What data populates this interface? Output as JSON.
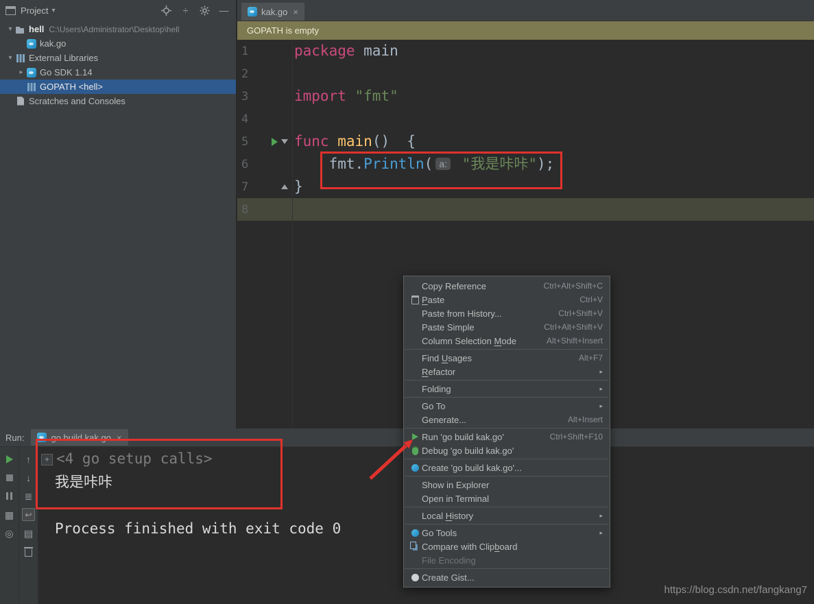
{
  "window": {
    "watermark": "https://blog.csdn.net/fangkang7"
  },
  "colors": {
    "annotation-red": "#e0322c",
    "selection-blue": "#2e5a8f",
    "banner-olive": "#7d7950",
    "keyword": "#cc4a7d",
    "string-green": "#6a8759",
    "function-yellow": "#ffc66d",
    "call-blue": "#4a9fd8",
    "plain-text": "#a9b7c6",
    "current-line": "#45483a",
    "run-green": "#4fa553"
  },
  "project_panel": {
    "title": "Project",
    "toolbar_icons": [
      "locate",
      "collapse-all",
      "settings",
      "hide"
    ],
    "tree": [
      {
        "label": "hell",
        "path": "C:\\Users\\Administrator\\Desktop\\hell",
        "icon": "folder",
        "chevron": "down",
        "depth": 0,
        "bold": true
      },
      {
        "label": "kak.go",
        "icon": "go-file",
        "chevron": "none",
        "depth": 1
      },
      {
        "label": "External Libraries",
        "icon": "library",
        "chevron": "down",
        "depth": 0
      },
      {
        "label": "Go SDK 1.14",
        "icon": "go-sdk",
        "chevron": "right",
        "depth": 1
      },
      {
        "label": "GOPATH <hell>",
        "icon": "library",
        "chevron": "none",
        "depth": 1,
        "selected": true
      },
      {
        "label": "Scratches and Consoles",
        "icon": "scratches",
        "chevron": "none",
        "depth": 0
      }
    ]
  },
  "editor": {
    "tab": {
      "label": "kak.go",
      "close": "×"
    },
    "banner": {
      "text": "GOPATH is empty"
    },
    "code": {
      "lines": [
        {
          "n": 1,
          "tokens": [
            {
              "t": "package",
              "c": "kw"
            },
            {
              "t": " main",
              "c": "pl"
            }
          ]
        },
        {
          "n": 2,
          "tokens": []
        },
        {
          "n": 3,
          "tokens": [
            {
              "t": "import",
              "c": "kw"
            },
            {
              "t": " ",
              "c": "pl"
            },
            {
              "t": "\"fmt\"",
              "c": "str"
            }
          ]
        },
        {
          "n": 4,
          "tokens": []
        },
        {
          "n": 5,
          "gutter": [
            "run",
            "fold-down"
          ],
          "tokens": [
            {
              "t": "func",
              "c": "kw"
            },
            {
              "t": " ",
              "c": "pl"
            },
            {
              "t": "main",
              "c": "fn"
            },
            {
              "t": "()  {",
              "c": "pl"
            }
          ]
        },
        {
          "n": 6,
          "tokens": [
            {
              "t": "    fmt.",
              "c": "pl"
            },
            {
              "t": "Println",
              "c": "call"
            },
            {
              "t": "(",
              "c": "pl"
            },
            {
              "hint": "a:"
            },
            {
              "t": " ",
              "c": "pl"
            },
            {
              "t": "\"我是咔咔\"",
              "c": "str"
            },
            {
              "t": ");",
              "c": "pl"
            }
          ]
        },
        {
          "n": 7,
          "gutter": [
            "fold-up"
          ],
          "tokens": [
            {
              "t": "}",
              "c": "pl"
            }
          ]
        },
        {
          "n": 8,
          "current": true,
          "tokens": []
        }
      ]
    }
  },
  "context_menu": {
    "items": [
      {
        "label": "Copy Reference",
        "shortcut": "Ctrl+Alt+Shift+C"
      },
      {
        "label": "Paste",
        "shortcut": "Ctrl+V",
        "icon": "paste",
        "mnemonic": "P"
      },
      {
        "label": "Paste from History...",
        "shortcut": "Ctrl+Shift+V"
      },
      {
        "label": "Paste Simple",
        "shortcut": "Ctrl+Alt+Shift+V"
      },
      {
        "label": "Column Selection Mode",
        "shortcut": "Alt+Shift+Insert",
        "mnemonic": "M"
      },
      {
        "separator": true
      },
      {
        "label": "Find Usages",
        "shortcut": "Alt+F7",
        "mnemonic": "U"
      },
      {
        "label": "Refactor",
        "submenu": true,
        "mnemonic": "R"
      },
      {
        "separator": true
      },
      {
        "label": "Folding",
        "submenu": true
      },
      {
        "separator": true
      },
      {
        "label": "Go To",
        "submenu": true
      },
      {
        "label": "Generate...",
        "shortcut": "Alt+Insert"
      },
      {
        "separator": true
      },
      {
        "label": "Run 'go build kak.go'",
        "shortcut": "Ctrl+Shift+F10",
        "icon": "run"
      },
      {
        "label": "Debug 'go build kak.go'",
        "icon": "debug"
      },
      {
        "separator": true
      },
      {
        "label": "Create 'go build kak.go'...",
        "icon": "go"
      },
      {
        "separator": true
      },
      {
        "label": "Show in Explorer"
      },
      {
        "label": "Open in Terminal"
      },
      {
        "separator": true
      },
      {
        "label": "Local History",
        "submenu": true,
        "mnemonic": "H"
      },
      {
        "separator": true
      },
      {
        "label": "Go Tools",
        "submenu": true,
        "icon": "go"
      },
      {
        "label": "Compare with Clipboard",
        "icon": "compare",
        "mnemonic": "b"
      },
      {
        "label": "File Encoding",
        "disabled": true
      },
      {
        "separator": true
      },
      {
        "label": "Create Gist...",
        "icon": "gist"
      }
    ]
  },
  "run_panel": {
    "label": "Run:",
    "tab": {
      "label": "go build kak.go",
      "close": "×"
    },
    "toolbar_main": [
      "rerun",
      "stop",
      "pause",
      "grid",
      "pin"
    ],
    "toolbar_console": [
      "up",
      "down",
      "console-menu",
      "soft-wrap",
      "print",
      "trash"
    ],
    "console": {
      "lines": [
        {
          "text": "<4 go setup calls>",
          "style": "dim",
          "fold": "+"
        },
        {
          "text": "我是咔咔",
          "style": "normal"
        },
        {
          "text": "",
          "style": "normal"
        },
        {
          "text": "Process finished with exit code 0",
          "style": "normal"
        }
      ]
    }
  }
}
